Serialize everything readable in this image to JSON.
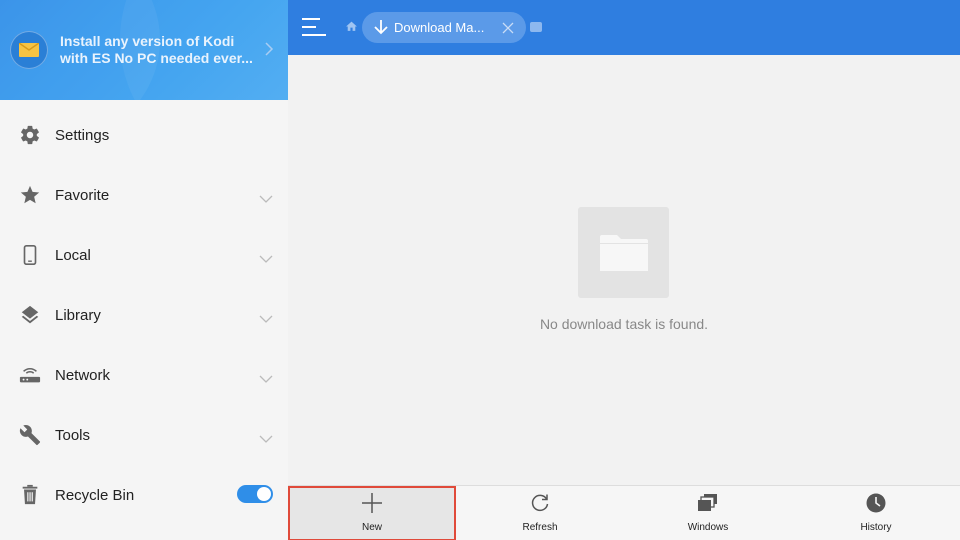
{
  "promo": {
    "line1": "Install any version of Kodi",
    "line2": "with ES No PC needed ever..."
  },
  "sidebar": {
    "items": [
      {
        "label": "Settings",
        "icon": "gear-icon",
        "expandable": false
      },
      {
        "label": "Favorite",
        "icon": "star-icon",
        "expandable": true
      },
      {
        "label": "Local",
        "icon": "phone-icon",
        "expandable": true
      },
      {
        "label": "Library",
        "icon": "layers-icon",
        "expandable": true
      },
      {
        "label": "Network",
        "icon": "network-icon",
        "expandable": true
      },
      {
        "label": "Tools",
        "icon": "wrench-icon",
        "expandable": true
      },
      {
        "label": "Recycle Bin",
        "icon": "trash-icon",
        "toggle": true,
        "toggle_on": true
      }
    ]
  },
  "topbar": {
    "tab_label": "Download Ma..."
  },
  "main": {
    "empty_message": "No download task is found."
  },
  "toolbar": {
    "items": [
      {
        "label": "New",
        "icon": "plus-icon",
        "selected": true
      },
      {
        "label": "Refresh",
        "icon": "refresh-icon",
        "selected": false
      },
      {
        "label": "Windows",
        "icon": "windows-icon",
        "selected": false
      },
      {
        "label": "History",
        "icon": "clock-icon",
        "selected": false
      }
    ]
  },
  "colors": {
    "primary_blue": "#2f7ee0",
    "toggle_blue": "#2f8ee8",
    "selection_outline": "#e04a3a"
  }
}
